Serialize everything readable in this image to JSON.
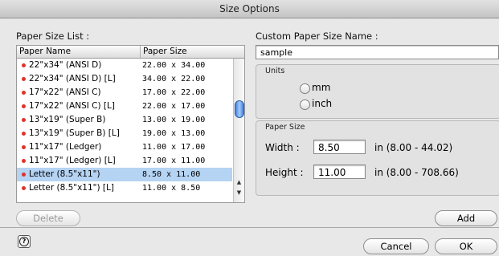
{
  "window": {
    "title": "Size Options"
  },
  "paper_list": {
    "label": "Paper Size List :",
    "columns": {
      "name": "Paper Name",
      "size": "Paper Size"
    },
    "rows": [
      {
        "name": "22\"x34\" (ANSI D)",
        "size": "22.00 x 34.00",
        "selected": false
      },
      {
        "name": "22\"x34\" (ANSI D) [L]",
        "size": "34.00 x 22.00",
        "selected": false
      },
      {
        "name": "17\"x22\" (ANSI C)",
        "size": "17.00 x 22.00",
        "selected": false
      },
      {
        "name": "17\"x22\" (ANSI C) [L]",
        "size": "22.00 x 17.00",
        "selected": false
      },
      {
        "name": "13\"x19\" (Super B)",
        "size": "13.00 x 19.00",
        "selected": false
      },
      {
        "name": "13\"x19\" (Super B) [L]",
        "size": "19.00 x 13.00",
        "selected": false
      },
      {
        "name": "11\"x17\" (Ledger)",
        "size": "11.00 x 17.00",
        "selected": false
      },
      {
        "name": "11\"x17\" (Ledger) [L]",
        "size": "17.00 x 11.00",
        "selected": false
      },
      {
        "name": "Letter (8.5\"x11\")",
        "size": "8.50 x 11.00",
        "selected": true
      },
      {
        "name": "Letter (8.5\"x11\") [L]",
        "size": "11.00 x 8.50",
        "selected": false
      }
    ],
    "delete_label": "Delete"
  },
  "custom": {
    "label": "Custom Paper Size Name :",
    "name_value": "sample",
    "units": {
      "title": "Units",
      "options": [
        "mm",
        "inch"
      ]
    },
    "paper_size": {
      "title": "Paper Size",
      "width_label": "Width :",
      "width_value": "8.50",
      "width_range": "in (8.00 - 44.02)",
      "height_label": "Height :",
      "height_value": "11.00",
      "height_range": "in (8.00 - 708.66)"
    },
    "add_label": "Add"
  },
  "footer": {
    "cancel_label": "Cancel",
    "ok_label": "OK",
    "help_icon": "help-icon"
  },
  "colors": {
    "selection": "#b5d3f3",
    "bullet": "#e0312b"
  }
}
